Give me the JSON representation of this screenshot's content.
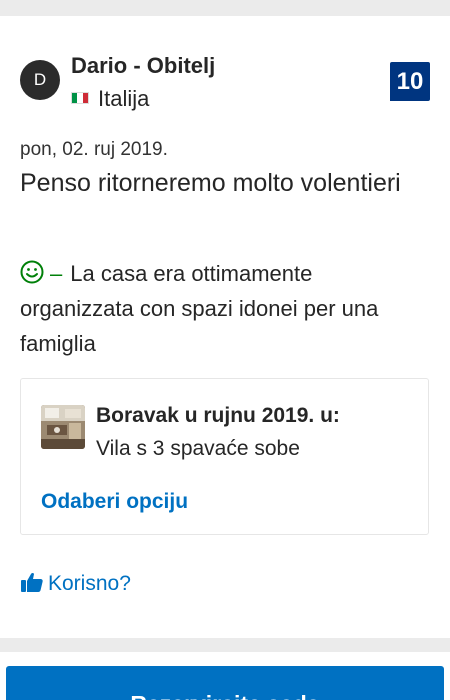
{
  "review": {
    "avatar_initial": "D",
    "reviewer_name": "Dario - Obitelj",
    "country": "Italija",
    "score": "10",
    "date": "pon, 02. ruj 2019.",
    "title": "Penso ritorneremo molto volentieri",
    "positive_dash": "–",
    "positive_text": "La casa era ottimamente organizzata con spazi idonei per una famiglia"
  },
  "stay": {
    "period": "Boravak u rujnu 2019. u:",
    "room": "Vila s 3 spavaće sobe",
    "choose_option": "Odaberi opciju"
  },
  "helpful": {
    "label": "Korisno?"
  },
  "bottom_button": {
    "label": "Rezervirajte sada"
  },
  "colors": {
    "score_badge": "#003580",
    "link": "#0071c2",
    "positive": "#008009",
    "divider": "#ebebeb"
  },
  "icons": {
    "flag": "italy-flag-icon",
    "smile": "smile-icon",
    "thumb": "thumbs-up-icon"
  }
}
